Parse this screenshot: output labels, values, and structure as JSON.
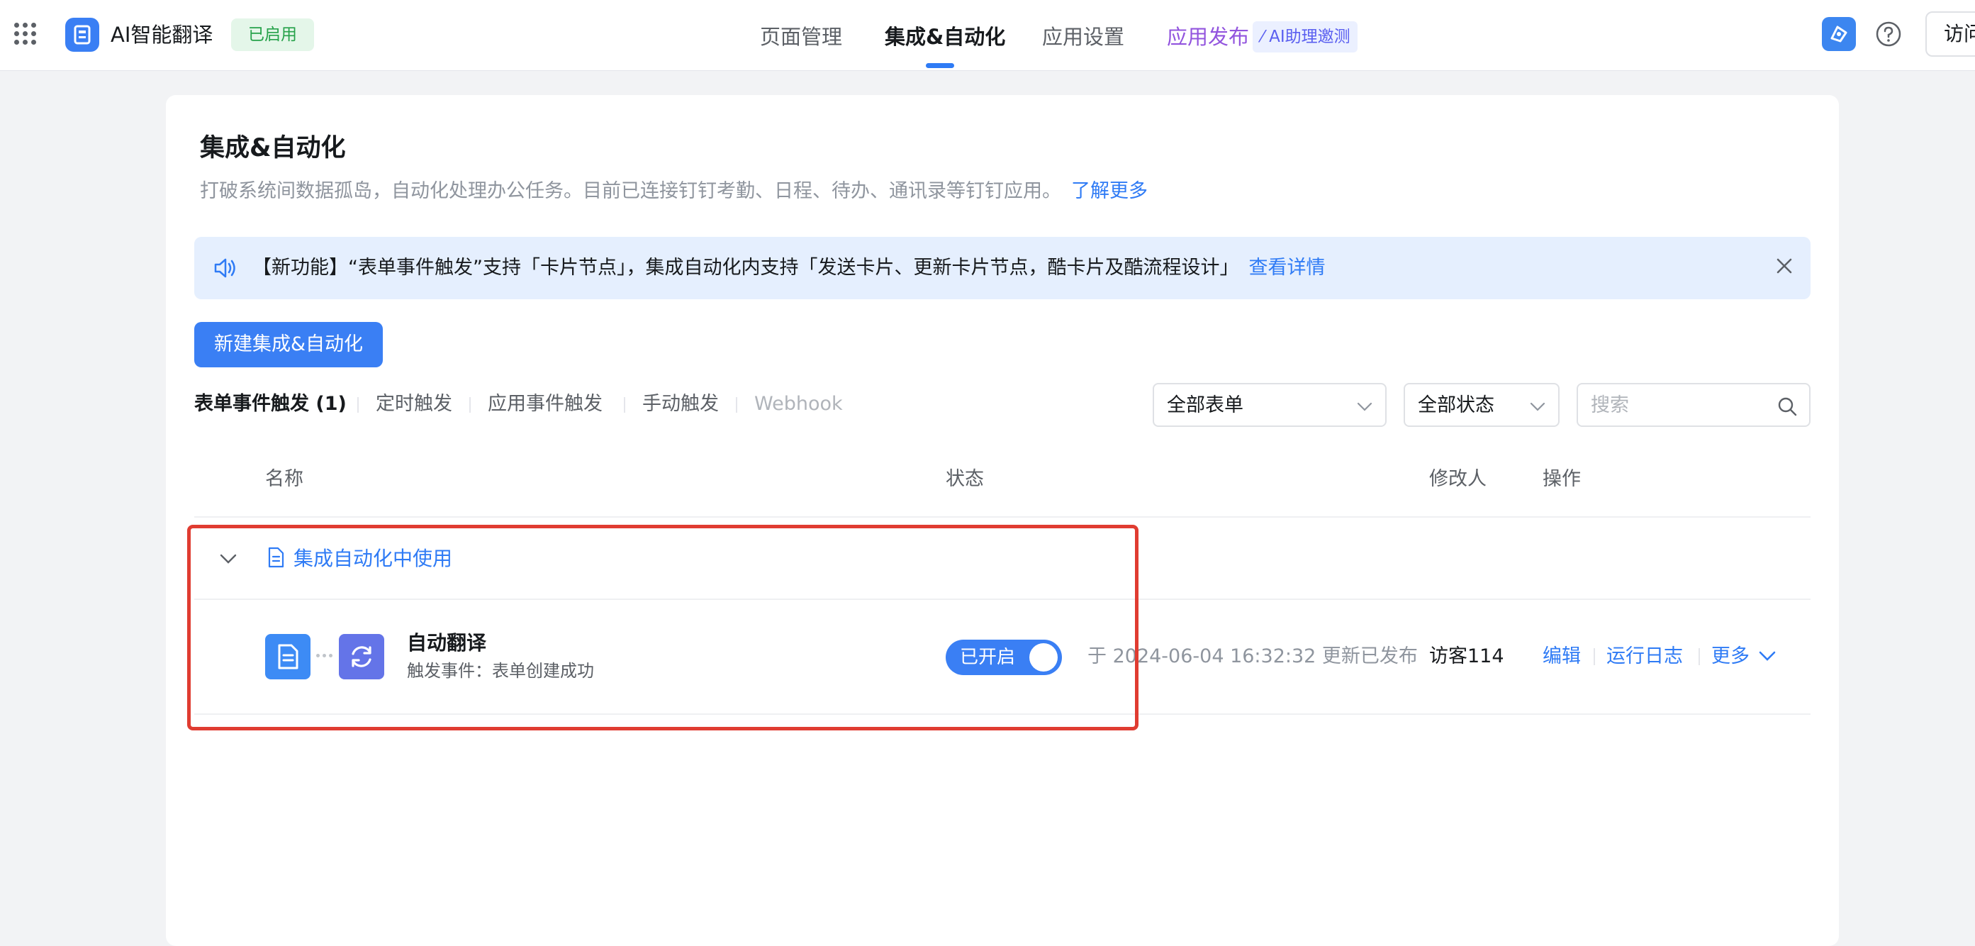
{
  "topbar": {
    "app_name": "AI智能翻译",
    "status_badge": "已启用",
    "nav": {
      "page_manage": "页面管理",
      "integration": "集成&自动化",
      "app_settings": "应用设置",
      "publish": "应用发布",
      "ai_invite": "AI助理邀测"
    },
    "visit_label": "访问"
  },
  "page": {
    "title": "集成&自动化",
    "description": "打破系统间数据孤岛，自动化处理办公任务。目前已连接钉钉考勤、日程、待办、通讯录等钉钉应用。",
    "learn_more": "了解更多"
  },
  "notice": {
    "text": "【新功能】“表单事件触发”支持「卡片节点」，集成自动化内支持「发送卡片、更新卡片节点，酷卡片及酷流程设计」",
    "link": "查看详情"
  },
  "new_button": "新建集成&自动化",
  "trigger_tabs": {
    "form_event": "表单事件触发 (1)",
    "scheduled": "定时触发",
    "app_event": "应用事件触发",
    "manual": "手动触发",
    "webhook": "Webhook"
  },
  "filters": {
    "form_select": "全部表单",
    "status_select": "全部状态",
    "search_placeholder": "搜索"
  },
  "table": {
    "headers": {
      "name": "名称",
      "status": "状态",
      "modifier": "修改人",
      "actions": "操作"
    },
    "group_label": "集成自动化中使用",
    "rows": [
      {
        "name": "自动翻译",
        "trigger": "触发事件：表单创建成功",
        "toggle_label": "已开启",
        "status_text": "于 2024-06-04 16:32:32 更新已发布",
        "modifier": "访客114",
        "actions": {
          "edit": "编辑",
          "log": "运行日志",
          "more": "更多"
        }
      }
    ]
  },
  "colors": {
    "primary": "#3a7ff4",
    "link": "#2f7bf5",
    "success_bg": "#e4f6e9",
    "success_text": "#26a24a",
    "notice_bg": "#e5effe",
    "highlight_border": "#e03c31"
  }
}
